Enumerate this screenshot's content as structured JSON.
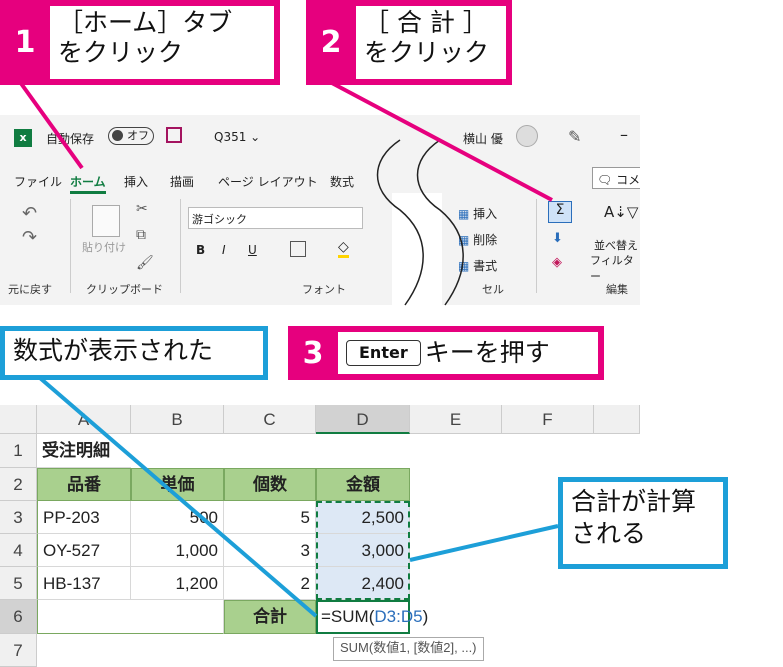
{
  "callouts": {
    "step1": {
      "num": "1",
      "text": "［ホーム］タブ\nをクリック"
    },
    "step2": {
      "num": "2",
      "text": "［ 合 計 ］\nをクリック"
    },
    "step3": {
      "num": "3",
      "key": "Enter",
      "text": "キーを押す"
    },
    "formula_shown": "数式が表示された",
    "sum_calc": "合計が計算\nされる"
  },
  "titlebar": {
    "autosave": "自動保存",
    "toggle": "オフ",
    "filename": "Q351 ⌄",
    "user": "横山 優"
  },
  "tabs": [
    "ファイル",
    "ホーム",
    "挿入",
    "描画",
    "ページ レイアウト",
    "数式"
  ],
  "ribbon": {
    "undo_label": "元に戻す",
    "paste_label": "貼り付け",
    "clipboard_label": "クリップボード",
    "font_name": "游ゴシック",
    "font_label": "フォント",
    "insert": "挿入",
    "delete": "削除",
    "format": "書式",
    "cells_label": "セル",
    "sort_filter_line1": "並べ替え",
    "sort_filter_line2": "フィルター",
    "editing_label": "編集",
    "comment": "コメ",
    "bold": "B",
    "italic": "I",
    "underline": "U"
  },
  "sheet": {
    "columns": [
      "A",
      "B",
      "C",
      "D",
      "E",
      "F"
    ],
    "rows": [
      "1",
      "2",
      "3",
      "4",
      "5",
      "6",
      "7"
    ],
    "title": "受注明細",
    "headers": [
      "品番",
      "単価",
      "個数",
      "金額"
    ],
    "data": [
      [
        "PP-203",
        "500",
        "5",
        "2,500"
      ],
      [
        "OY-527",
        "1,000",
        "3",
        "3,000"
      ],
      [
        "HB-137",
        "1,200",
        "2",
        "2,400"
      ]
    ],
    "total_label": "合計",
    "formula_prefix": "=SUM(",
    "formula_range": "D3:D5",
    "formula_suffix": ")",
    "tooltip": "SUM(数値1, [数値2], ...)"
  },
  "colors": {
    "magenta": "#e6007e",
    "blue": "#1d9fd8",
    "header_green": "#a9d08e",
    "excel_green": "#107c41"
  }
}
